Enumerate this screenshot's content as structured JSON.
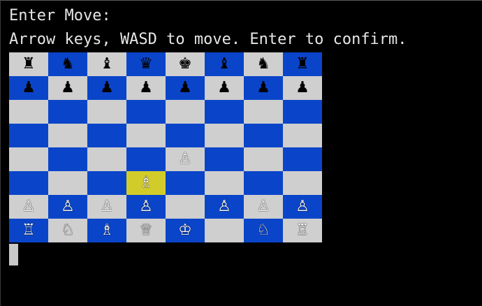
{
  "prompt": {
    "line1": "Enter Move:",
    "line2": "Arrow keys, WASD to move. Enter to confirm."
  },
  "colors": {
    "light_square": "#cfcfcf",
    "dark_square": "#0a45c9",
    "selected_square": "#d2cc2a"
  },
  "board": {
    "selected": [
      5,
      3
    ],
    "rows": [
      [
        "♜",
        "♞",
        "♝",
        "♛",
        "♚",
        "♝",
        "♞",
        "♜"
      ],
      [
        "♟",
        "♟",
        "♟",
        "♟",
        "♟",
        "♟",
        "♟",
        "♟"
      ],
      [
        "",
        "",
        "",
        "",
        "",
        "",
        "",
        ""
      ],
      [
        "",
        "",
        "",
        "",
        "",
        "",
        "",
        ""
      ],
      [
        "",
        "",
        "",
        "",
        "♙",
        "",
        "",
        ""
      ],
      [
        "",
        "",
        "",
        "♗",
        "",
        "",
        "",
        ""
      ],
      [
        "♙",
        "♙",
        "♙",
        "♙",
        "",
        "♙",
        "♙",
        "♙"
      ],
      [
        "♖",
        "♘",
        "♗",
        "♕",
        "♔",
        "",
        "♘",
        "♖"
      ]
    ]
  }
}
